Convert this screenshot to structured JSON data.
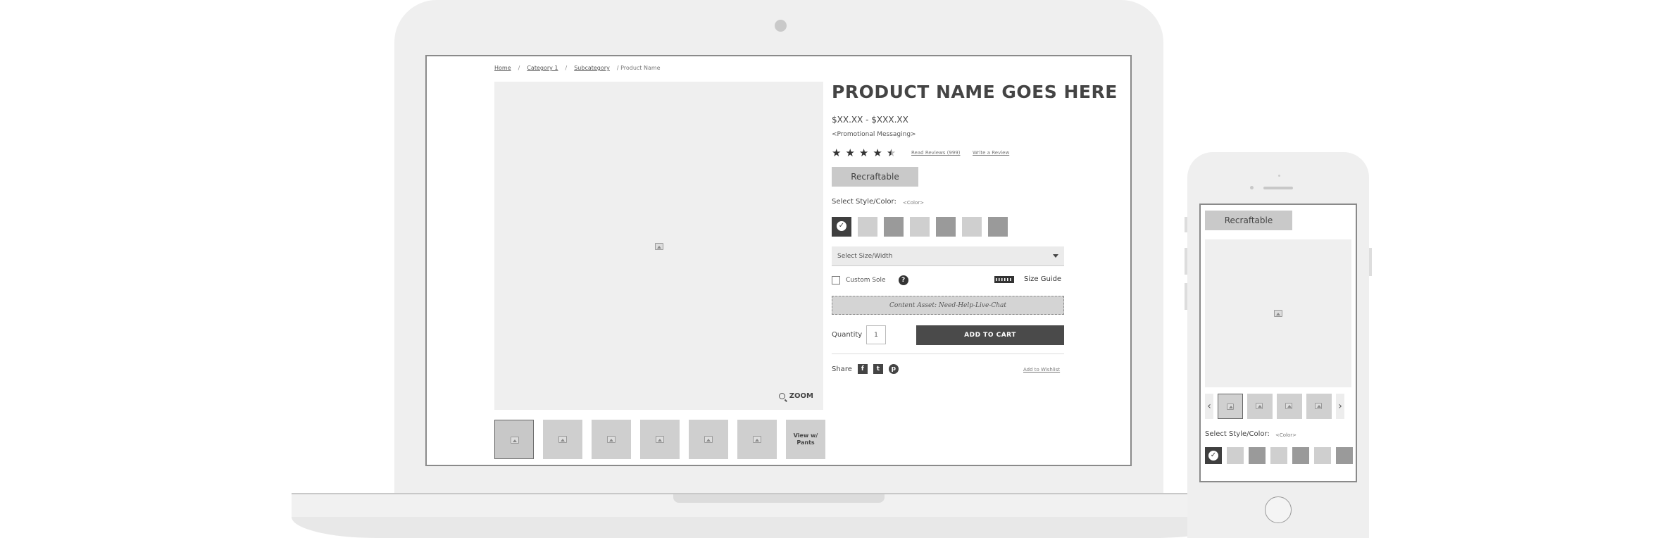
{
  "breadcrumb": {
    "items": [
      "Home",
      "Category 1",
      "Subcategory"
    ],
    "current": "Product Name",
    "separator": "/"
  },
  "product": {
    "title": "PRODUCT NAME GOES HERE",
    "price": "$XX.XX - $XXX.XX",
    "promo": "<Promotional Messaging>",
    "rating": 4.5,
    "read_reviews": "Read Reviews (999)",
    "write_review": "Write a Review",
    "recraftable": "Recraftable",
    "style_label": "Select Style/Color:",
    "style_color_placeholder": "<Color>",
    "size_placeholder": "Select Size/Width",
    "custom_sole": "Custom Sole",
    "help": "?",
    "size_guide": "Size Guide",
    "chat_asset": "Content Asset: Need-Help-Live-Chat",
    "quantity_label": "Quantity",
    "quantity_value": "1",
    "add_to_cart": "ADD TO CART",
    "share_label": "Share",
    "social": {
      "facebook": "f",
      "twitter": "t",
      "pinterest": "p"
    },
    "wishlist": "Add to Wishlist"
  },
  "gallery": {
    "zoom_label": "ZOOM",
    "view_with_pants": "View w/ Pants",
    "thumb_count": 6
  },
  "swatches": [
    "selected",
    "light",
    "dark",
    "light",
    "dark",
    "light",
    "dark"
  ],
  "phone": {
    "recraftable": "Recraftable",
    "style_label": "Select Style/Color:",
    "style_color_placeholder": "<Color>",
    "prev": "‹",
    "next": "›"
  },
  "colors": {
    "device": "#efefef",
    "button_dark": "#4a4a4a",
    "swatch_light": "#cfcfcf",
    "swatch_dark": "#9a9a9a"
  }
}
